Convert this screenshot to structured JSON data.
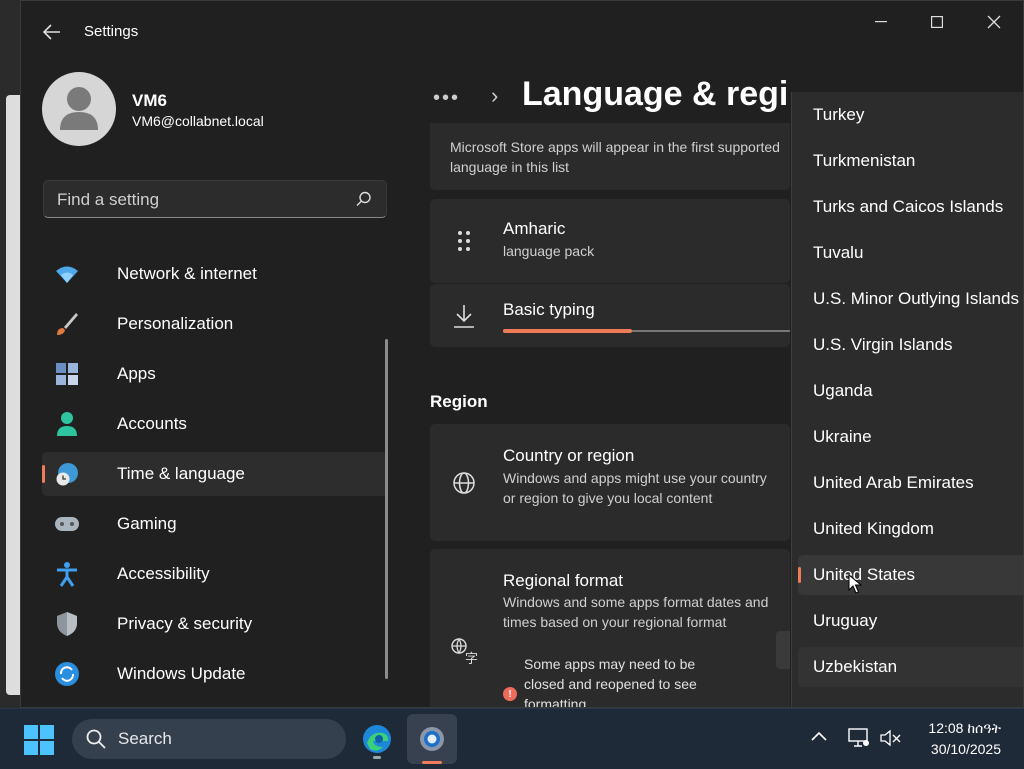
{
  "window": {
    "title": "Settings",
    "controls": {
      "minimize": "minimize",
      "maximize": "maximize",
      "close": "close"
    }
  },
  "profile": {
    "name": "VM6",
    "email": "VM6@collabnet.local"
  },
  "search": {
    "placeholder": "Find a setting"
  },
  "nav": {
    "items": [
      {
        "label": "Network & internet",
        "icon": "wifi-icon"
      },
      {
        "label": "Personalization",
        "icon": "brush-icon"
      },
      {
        "label": "Apps",
        "icon": "apps-icon"
      },
      {
        "label": "Accounts",
        "icon": "person-icon"
      },
      {
        "label": "Time & language",
        "icon": "globe-clock-icon",
        "selected": true
      },
      {
        "label": "Gaming",
        "icon": "gamepad-icon"
      },
      {
        "label": "Accessibility",
        "icon": "accessibility-icon"
      },
      {
        "label": "Privacy & security",
        "icon": "shield-icon"
      },
      {
        "label": "Windows Update",
        "icon": "sync-icon"
      }
    ]
  },
  "header": {
    "more": "•••",
    "title": "Language & regi"
  },
  "preferred_languages": {
    "note": "Microsoft Store apps will appear in the first supported language in this list",
    "language": {
      "name": "Amharic",
      "sub": "language pack"
    },
    "download": {
      "label": "Basic typing",
      "progress": 0.45
    }
  },
  "region": {
    "heading": "Region",
    "country": {
      "title": "Country or region",
      "description": "Windows and apps might use your country or region to give you local content"
    },
    "format": {
      "title": "Regional format",
      "description": "Windows and some apps format dates and times based on your regional format",
      "warning": "Some apps may need to be closed and reopened to see formatting"
    }
  },
  "country_dropdown": {
    "items": [
      "Turkey",
      "Turkmenistan",
      "Turks and Caicos Islands",
      "Tuvalu",
      "U.S. Minor Outlying Islands",
      "U.S. Virgin Islands",
      "Uganda",
      "Ukraine",
      "United Arab Emirates",
      "United Kingdom",
      "United States",
      "Uruguay",
      "Uzbekistan"
    ],
    "selected": "United States"
  },
  "taskbar": {
    "search_placeholder": "Search",
    "clock": {
      "time": "12:08 ከሰዓት",
      "date": "30/10/2025"
    }
  },
  "colors": {
    "accent": "#ef7b58",
    "window_bg": "#202020",
    "card_bg": "#2b2b2b",
    "taskbar_bg": "#1f2a38"
  }
}
